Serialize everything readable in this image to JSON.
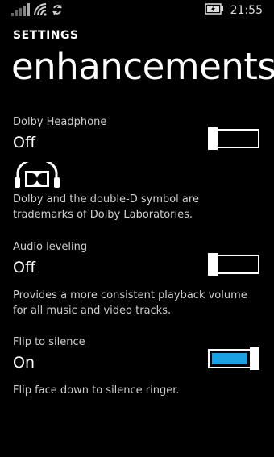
{
  "status": {
    "signal_icon": "signal-bars-icon",
    "wifi_icon": "wifi-icon",
    "sync_icon": "sync-icon",
    "battery_icon": "battery-charging-icon",
    "time": "21:55"
  },
  "header": {
    "section": "SETTINGS",
    "title": "enhancements"
  },
  "settings": [
    {
      "label": "Dolby Headphone",
      "value": "Off",
      "state": "off",
      "logo_icon": "dolby-headphone-icon",
      "description": "Dolby and the double-D symbol are trademarks of Dolby Laboratories."
    },
    {
      "label": "Audio leveling",
      "value": "Off",
      "state": "off",
      "description": "Provides a more consistent playback volume for all music and video tracks."
    },
    {
      "label": "Flip to silence",
      "value": "On",
      "state": "on",
      "description": "Flip face down to silence ringer."
    }
  ],
  "colors": {
    "accent": "#1ba1e2",
    "background": "#000000",
    "foreground": "#ffffff"
  }
}
